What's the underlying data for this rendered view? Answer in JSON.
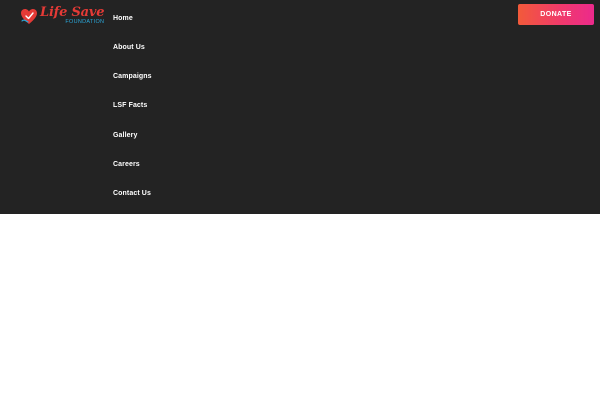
{
  "brand": {
    "name": "Life Save",
    "subtitle": "FOUNDATION",
    "primary_color": "#e43a36",
    "secondary_color": "#2aa6d8",
    "icon": "heart-hand-logo-icon"
  },
  "nav": {
    "items": [
      {
        "label": "Home"
      },
      {
        "label": "About Us"
      },
      {
        "label": "Campaigns"
      },
      {
        "label": "LSF Facts"
      },
      {
        "label": "Gallery"
      },
      {
        "label": "Careers"
      },
      {
        "label": "Contact Us"
      }
    ]
  },
  "header": {
    "background_color": "#232323",
    "donate_label": "DONATE",
    "donate_gradient": [
      "#f25a3a",
      "#ec2a8c"
    ]
  }
}
